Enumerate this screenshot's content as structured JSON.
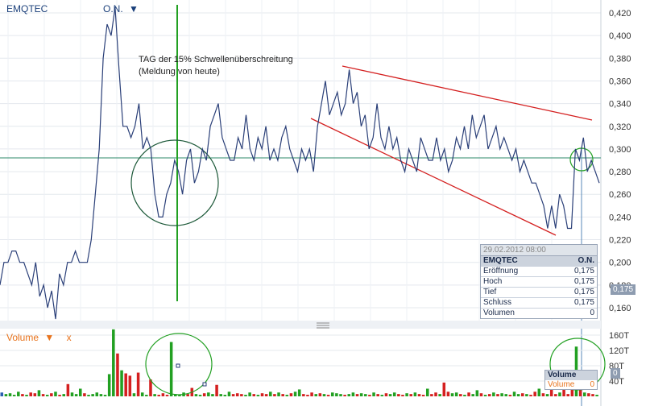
{
  "header": {
    "symbol": "EMQTEC",
    "exchange": "O.N.",
    "exchange_dropdown": "▼"
  },
  "annotation": {
    "line1": "TAG der 15% Schwellenüberschreitung",
    "line2": "(Meldung von heute)"
  },
  "volume_panel": {
    "label": "Volume",
    "dropdown": "▼",
    "close": "x"
  },
  "tooltip": {
    "date": "29.02.2012 08:00",
    "symbol": "EMQTEC",
    "exchange": "O.N.",
    "rows": [
      {
        "label": "Eröffnung",
        "value": "0,175"
      },
      {
        "label": "Hoch",
        "value": "0,175"
      },
      {
        "label": "Tief",
        "value": "0,175"
      },
      {
        "label": "Schluss",
        "value": "0,175"
      },
      {
        "label": "Volumen",
        "value": "0"
      }
    ]
  },
  "volume_tooltip": {
    "title": "Volume",
    "label": "Volume",
    "value": "0"
  },
  "price_tag": "0,175",
  "volume_tag": "0",
  "colors": {
    "price_line": "#2a3f78",
    "trend": "#d42020",
    "marker": "#22a022",
    "circle": "#1e5a3a",
    "up": "#22a022",
    "down": "#d42020",
    "neutral": "#2a5fb0"
  },
  "chart_data": [
    {
      "type": "line",
      "title": "EMQTEC",
      "yticks": [
        "0,420",
        "0,400",
        "0,380",
        "0,360",
        "0,340",
        "0,320",
        "0,300",
        "0,280",
        "0,260",
        "0,240",
        "0,220",
        "0,200",
        "0,180",
        "0,160"
      ],
      "ylim": [
        0.15,
        0.425
      ],
      "series": [
        {
          "values": [
            0.18,
            0.2,
            0.2,
            0.21,
            0.21,
            0.2,
            0.2,
            0.19,
            0.18,
            0.2,
            0.17,
            0.18,
            0.16,
            0.175,
            0.15,
            0.19,
            0.18,
            0.2,
            0.2,
            0.21,
            0.2,
            0.2,
            0.2,
            0.22,
            0.26,
            0.3,
            0.38,
            0.41,
            0.4,
            0.425,
            0.37,
            0.32,
            0.32,
            0.31,
            0.32,
            0.34,
            0.3,
            0.31,
            0.3,
            0.26,
            0.24,
            0.24,
            0.26,
            0.27,
            0.29,
            0.28,
            0.26,
            0.29,
            0.3,
            0.27,
            0.28,
            0.3,
            0.29,
            0.32,
            0.33,
            0.34,
            0.31,
            0.3,
            0.29,
            0.29,
            0.31,
            0.3,
            0.33,
            0.3,
            0.29,
            0.31,
            0.3,
            0.32,
            0.29,
            0.3,
            0.29,
            0.31,
            0.32,
            0.3,
            0.29,
            0.28,
            0.3,
            0.29,
            0.3,
            0.28,
            0.32,
            0.34,
            0.36,
            0.33,
            0.34,
            0.35,
            0.33,
            0.34,
            0.37,
            0.34,
            0.35,
            0.32,
            0.33,
            0.3,
            0.31,
            0.34,
            0.31,
            0.3,
            0.32,
            0.3,
            0.31,
            0.29,
            0.28,
            0.3,
            0.29,
            0.28,
            0.31,
            0.3,
            0.29,
            0.29,
            0.31,
            0.29,
            0.3,
            0.28,
            0.29,
            0.31,
            0.3,
            0.32,
            0.3,
            0.33,
            0.31,
            0.32,
            0.33,
            0.3,
            0.31,
            0.32,
            0.3,
            0.31,
            0.3,
            0.29,
            0.3,
            0.28,
            0.29,
            0.28,
            0.27,
            0.27,
            0.26,
            0.25,
            0.23,
            0.25,
            0.23,
            0.26,
            0.25,
            0.23,
            0.23,
            0.3,
            0.29,
            0.31,
            0.28,
            0.29,
            0.28,
            0.27
          ]
        }
      ]
    },
    {
      "type": "bar",
      "title": "Volume",
      "yticks": [
        "160T",
        "120T",
        "80T",
        "40T"
      ],
      "ylim": [
        0,
        175
      ],
      "series": [
        {
          "values": [
            10,
            6,
            8,
            4,
            12,
            6,
            4,
            10,
            8,
            16,
            6,
            4,
            8,
            12,
            4,
            6,
            32,
            10,
            6,
            20,
            8,
            4,
            6,
            10,
            6,
            4,
            58,
            175,
            112,
            68,
            60,
            54,
            8,
            62,
            10,
            4,
            44,
            6,
            4,
            8,
            4,
            142,
            6,
            4,
            10,
            6,
            22,
            6,
            4,
            8,
            10,
            6,
            30,
            6,
            4,
            12,
            6,
            8,
            6,
            4,
            10,
            6,
            4,
            8,
            6,
            12,
            6,
            10,
            6,
            4,
            8,
            12,
            18,
            6,
            4,
            10,
            6,
            8,
            6,
            4,
            10,
            8,
            6,
            4,
            6,
            10,
            6,
            8,
            6,
            4,
            10,
            6,
            4,
            8,
            6,
            10,
            6,
            4,
            8,
            6,
            10,
            6,
            4,
            20,
            6,
            10,
            6,
            36,
            12,
            8,
            10,
            6,
            4,
            10,
            6,
            16,
            8,
            4,
            6,
            10,
            6,
            8,
            6,
            4,
            12,
            6,
            8,
            6,
            4,
            12,
            20,
            8,
            6,
            40,
            6,
            10,
            20,
            6,
            40,
            130,
            20,
            10,
            8,
            6,
            4
          ]
        }
      ]
    }
  ]
}
